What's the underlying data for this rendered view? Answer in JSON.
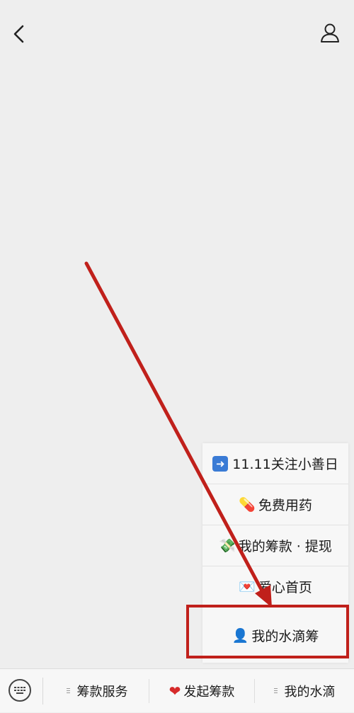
{
  "header": {
    "back_icon": "chevron-left-icon",
    "profile_icon": "user-outline-icon"
  },
  "menu": {
    "items": [
      {
        "icon": "arrow-right-icon",
        "label": "11.11关注小善日"
      },
      {
        "icon": "pill-icon",
        "label": "免费用药"
      },
      {
        "icon": "money-icon",
        "label": "我的筹款 · 提现"
      },
      {
        "icon": "heart-envelope-icon",
        "label": "爱心首页"
      },
      {
        "icon": "user-icon",
        "label": "我的水滴筹"
      }
    ],
    "highlighted_index": 4
  },
  "annotation": {
    "color": "#c0201b"
  },
  "bottom_bar": {
    "keyboard_icon": "keyboard-icon",
    "tabs": [
      {
        "label": "筹款服务"
      },
      {
        "label": "发起筹款",
        "icon": "heart-icon"
      },
      {
        "label": "我的水滴"
      }
    ]
  }
}
